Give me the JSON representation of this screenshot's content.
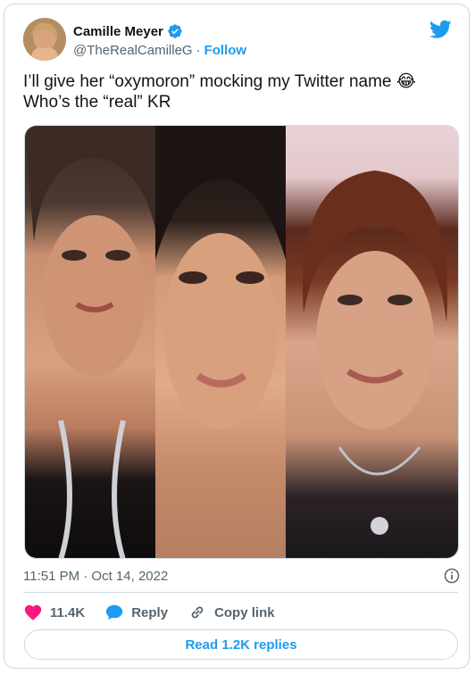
{
  "author": {
    "name": "Camille Meyer",
    "handle": "@TheRealCamilleG",
    "separator": "·",
    "follow_label": "Follow"
  },
  "tweet": {
    "text": "I’ll give her “oxymoron”  mocking my Twitter name 😂\nWho’s the “real” KR"
  },
  "meta": {
    "timestamp": "11:51 PM · Oct 14, 2022"
  },
  "actions": {
    "like_count": "11.4K",
    "reply_label": "Reply",
    "copy_link_label": "Copy link"
  },
  "footer": {
    "read_replies_label": "Read 1.2K replies"
  },
  "icons": {
    "twitter_bird": "twitter-bird-icon",
    "verified": "verified-badge-icon",
    "info": "info-icon",
    "heart": "heart-icon",
    "reply": "reply-bubble-icon",
    "link": "link-icon"
  },
  "colors": {
    "brand_blue": "#1d9bf0",
    "like_red": "#f91880",
    "text_primary": "#0f1419",
    "text_secondary": "#536471",
    "border": "#cfd9de"
  }
}
